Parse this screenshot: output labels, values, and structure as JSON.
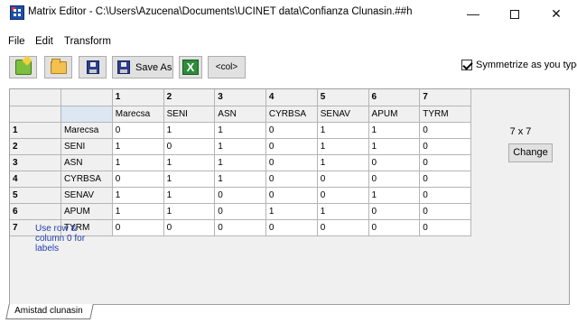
{
  "window": {
    "title": "Matrix Editor - C:\\Users\\Azucena\\Documents\\UCINET data\\Confianza Clunasin.##h",
    "minimize_glyph": "—",
    "close_glyph": "✕"
  },
  "menu": {
    "file": "File",
    "edit": "Edit",
    "transform": "Transform"
  },
  "toolbar": {
    "new_icon": "new-file-icon",
    "open_icon": "open-folder-icon",
    "save_icon": "save-disk-icon",
    "save_as_label": "Save As",
    "excel_glyph": "X",
    "col_label": "<col>",
    "symmetrize_label": "Symmetrize as you type",
    "symmetrize_checked": true
  },
  "matrix": {
    "col_numbers": [
      "1",
      "2",
      "3",
      "4",
      "5",
      "6",
      "7"
    ],
    "col_labels": [
      "Marecsa",
      "SENI",
      "ASN",
      "CYRBSA",
      "SENAV",
      "APUM",
      "TYRM"
    ],
    "rows": [
      {
        "num": "1",
        "label": "Marecsa",
        "values": [
          "0",
          "1",
          "1",
          "0",
          "1",
          "1",
          "0"
        ]
      },
      {
        "num": "2",
        "label": "SENI",
        "values": [
          "1",
          "0",
          "1",
          "0",
          "1",
          "1",
          "0"
        ]
      },
      {
        "num": "3",
        "label": "ASN",
        "values": [
          "1",
          "1",
          "1",
          "0",
          "1",
          "0",
          "0"
        ]
      },
      {
        "num": "4",
        "label": "CYRBSA",
        "values": [
          "0",
          "1",
          "1",
          "0",
          "0",
          "0",
          "0"
        ]
      },
      {
        "num": "5",
        "label": "SENAV",
        "values": [
          "1",
          "1",
          "0",
          "0",
          "0",
          "1",
          "0"
        ]
      },
      {
        "num": "6",
        "label": "APUM",
        "values": [
          "1",
          "1",
          "0",
          "1",
          "1",
          "0",
          "0"
        ]
      },
      {
        "num": "7",
        "label": "TYRM",
        "values": [
          "0",
          "0",
          "0",
          "0",
          "0",
          "0",
          "0"
        ]
      }
    ]
  },
  "panel": {
    "dimensions": "7 x 7",
    "change_label": "Change",
    "hint": "Use row & column 0 for labels"
  },
  "sheet_tab": "Amistad clunasin"
}
